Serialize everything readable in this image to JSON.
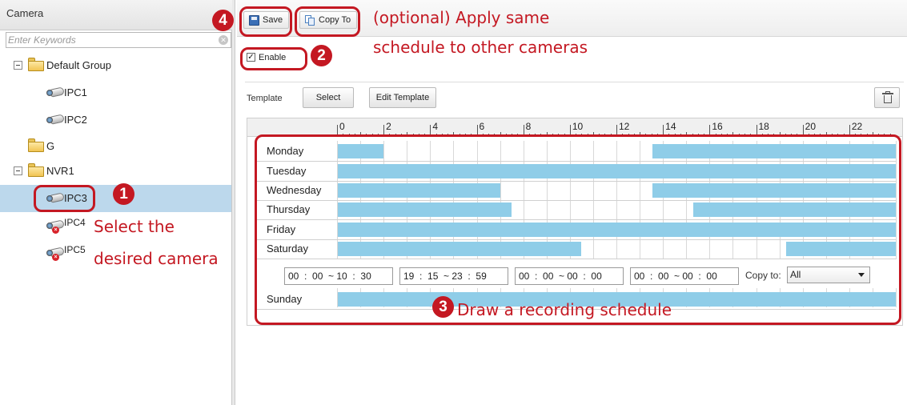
{
  "camera_panel": {
    "title": "Camera",
    "search_placeholder": "Enter Keywords",
    "tree": [
      {
        "label": "Default Group",
        "type": "group",
        "expanded": true
      },
      {
        "label": "IPC1",
        "type": "camera",
        "status": "online"
      },
      {
        "label": "IPC2",
        "type": "camera",
        "status": "online"
      },
      {
        "label": "G",
        "type": "group"
      },
      {
        "label": "NVR1",
        "type": "group",
        "expanded": true
      },
      {
        "label": "IPC3",
        "type": "camera",
        "status": "online",
        "selected": true
      },
      {
        "label": "IPC4",
        "type": "camera",
        "status": "offline"
      },
      {
        "label": "IPC5",
        "type": "camera",
        "status": "offline"
      }
    ]
  },
  "toolbar": {
    "save_label": "Save",
    "copy_to_label": "Copy To"
  },
  "enable": {
    "label": "Enable",
    "checked": true
  },
  "template": {
    "label": "Template",
    "select_label": "Select",
    "edit_label": "Edit Template",
    "delete_icon": "trash-icon"
  },
  "schedule": {
    "hour_labels": [
      "0",
      "2",
      "4",
      "6",
      "8",
      "10",
      "12",
      "14",
      "16",
      "18",
      "20",
      "22"
    ],
    "days": [
      {
        "name": "Monday",
        "segments": [
          [
            0,
            2
          ],
          [
            13.5,
            24
          ]
        ]
      },
      {
        "name": "Tuesday",
        "segments": [
          [
            0,
            24
          ]
        ]
      },
      {
        "name": "Wednesday",
        "segments": [
          [
            0,
            7
          ]
        ],
        "segments_extra": [
          [
            13.5,
            24
          ]
        ]
      },
      {
        "name": "Thursday",
        "segments": [
          [
            0,
            7.5
          ],
          [
            15.25,
            24
          ]
        ]
      },
      {
        "name": "Friday",
        "segments": [
          [
            0,
            24
          ]
        ]
      },
      {
        "name": "Saturday",
        "segments": [
          [
            0,
            10.5
          ],
          [
            19.25,
            24
          ]
        ]
      },
      {
        "name": "Sunday",
        "segments": [
          [
            0,
            24
          ]
        ]
      }
    ],
    "time_ranges": [
      "00  :  00  ~ 10  :  30",
      "19  :  15  ~ 23  :  59",
      "00  :  00  ~ 00  :  00",
      "00  :  00  ~ 00  :  00"
    ],
    "copy_to_label": "Copy to:",
    "copy_to_value": "All",
    "bar_color": "#8fcde8"
  },
  "annotations": {
    "step1": "1",
    "step2": "2",
    "step3": "3",
    "step4": "4",
    "note_select_line1": "Select the",
    "note_select_line2": "desired camera",
    "note_copy_line1": "(optional) Apply same",
    "note_copy_line2": "schedule to other cameras",
    "note_draw": "Draw a recording schedule",
    "accent_color": "#c41822"
  }
}
